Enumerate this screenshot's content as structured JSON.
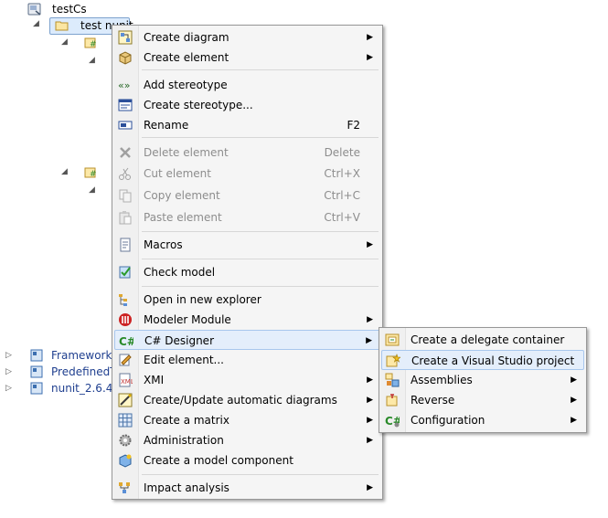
{
  "tree": {
    "root_label": "testCs",
    "child_label": "test nunit",
    "nodes": [
      {
        "label": "FrameworkC"
      },
      {
        "label": "PredefinedTy"
      },
      {
        "label": "nunit_2.6.4 1"
      }
    ]
  },
  "context_menu": {
    "items": [
      {
        "label": "Create diagram",
        "icon": "diagram-icon",
        "submenu": true
      },
      {
        "label": "Create element",
        "icon": "element-box-icon",
        "submenu": true
      },
      {
        "label": "Add stereotype",
        "icon": "stereotype-icon"
      },
      {
        "label": "Create stereotype...",
        "icon": "create-stereotype-icon"
      },
      {
        "label": "Rename",
        "icon": "rename-icon",
        "shortcut": "F2"
      },
      {
        "label": "Delete element",
        "icon": "delete-icon",
        "shortcut": "Delete",
        "disabled": true
      },
      {
        "label": "Cut element",
        "icon": "scissors-icon",
        "shortcut": "Ctrl+X",
        "disabled": true
      },
      {
        "label": "Copy element",
        "icon": "copy-icon",
        "shortcut": "Ctrl+C",
        "disabled": true
      },
      {
        "label": "Paste element",
        "icon": "paste-icon",
        "shortcut": "Ctrl+V",
        "disabled": true
      },
      {
        "label": "Macros",
        "icon": "macro-icon",
        "submenu": true
      },
      {
        "label": "Check model",
        "icon": "check-model-icon"
      },
      {
        "label": "Open in new explorer",
        "icon": "explorer-icon"
      },
      {
        "label": "Modeler Module",
        "icon": "modeler-module-icon",
        "submenu": true
      },
      {
        "label": "C# Designer",
        "icon": "csharp-icon",
        "submenu": true
      },
      {
        "label": "Edit element...",
        "icon": "edit-icon"
      },
      {
        "label": "XMI",
        "icon": "xmi-icon",
        "submenu": true
      },
      {
        "label": "Create/Update automatic diagrams",
        "icon": "auto-diagram-icon",
        "submenu": true
      },
      {
        "label": "Create a matrix",
        "icon": "matrix-icon",
        "submenu": true
      },
      {
        "label": "Administration",
        "icon": "gear-icon",
        "submenu": true
      },
      {
        "label": "Create a model component",
        "icon": "model-component-icon"
      },
      {
        "label": "Impact analysis",
        "icon": "impact-icon",
        "submenu": true
      }
    ]
  },
  "submenu": {
    "items": [
      {
        "label": "Create a delegate container",
        "icon": "delegate-container-icon"
      },
      {
        "label": "Create a Visual Studio project",
        "icon": "vs-project-icon"
      },
      {
        "label": "Assemblies",
        "icon": "assemblies-icon",
        "submenu": true
      },
      {
        "label": "Reverse",
        "icon": "reverse-icon",
        "submenu": true
      },
      {
        "label": "Configuration",
        "icon": "csharp-config-icon",
        "submenu": true
      }
    ]
  },
  "colors": {
    "selection_bg": "#dcebfc",
    "selection_border": "#7da2ce",
    "menu_bg": "#f5f5f5",
    "highlight_bg": "#e4eefb",
    "disabled_text": "#8d8d8d",
    "link_text": "#1f3f8f"
  }
}
